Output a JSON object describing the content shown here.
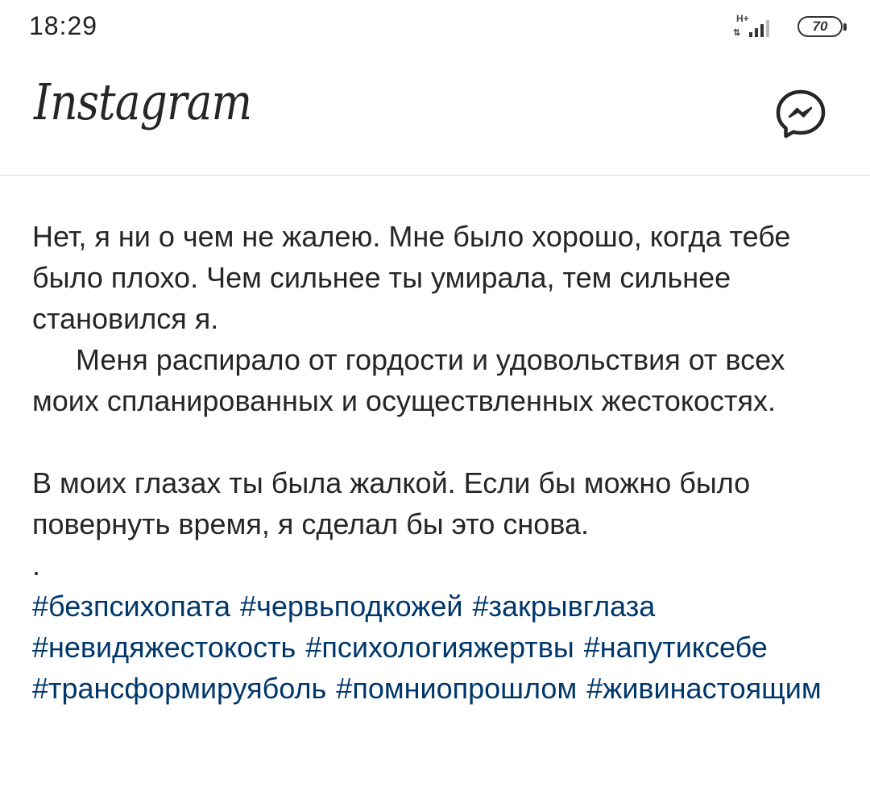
{
  "status_bar": {
    "time": "18:29",
    "network_type": "H+",
    "battery_level": "70"
  },
  "header": {
    "logo_text": "Instagram",
    "messenger_icon": "messenger-icon"
  },
  "post": {
    "caption": {
      "paragraph_1": "Нет, я ни о чем не жалею. Мне было хорошо, когда тебе было плохо. Чем сильнее ты умирала, тем сильнее становился я.",
      "paragraph_2": "Меня распирало от гордости и удовольствия от всех моих спланированных и осуществленных жестокостях.",
      "paragraph_3": "В моих глазах ты была жалкой. Если бы можно было повернуть время, я сделал бы это снова.",
      "separator": ".",
      "hashtags": [
        "#безпсихопата",
        "#червьподкожей",
        "#закрывглаза",
        "#невидяжестокость",
        "#психологияжертвы",
        "#напутиксебе",
        "#трансформируяболь",
        "#помниопрошлом",
        "#живинастоящим"
      ]
    }
  },
  "colors": {
    "text": "#262626",
    "hashtag": "#00376b",
    "divider": "#dbdbdb"
  }
}
